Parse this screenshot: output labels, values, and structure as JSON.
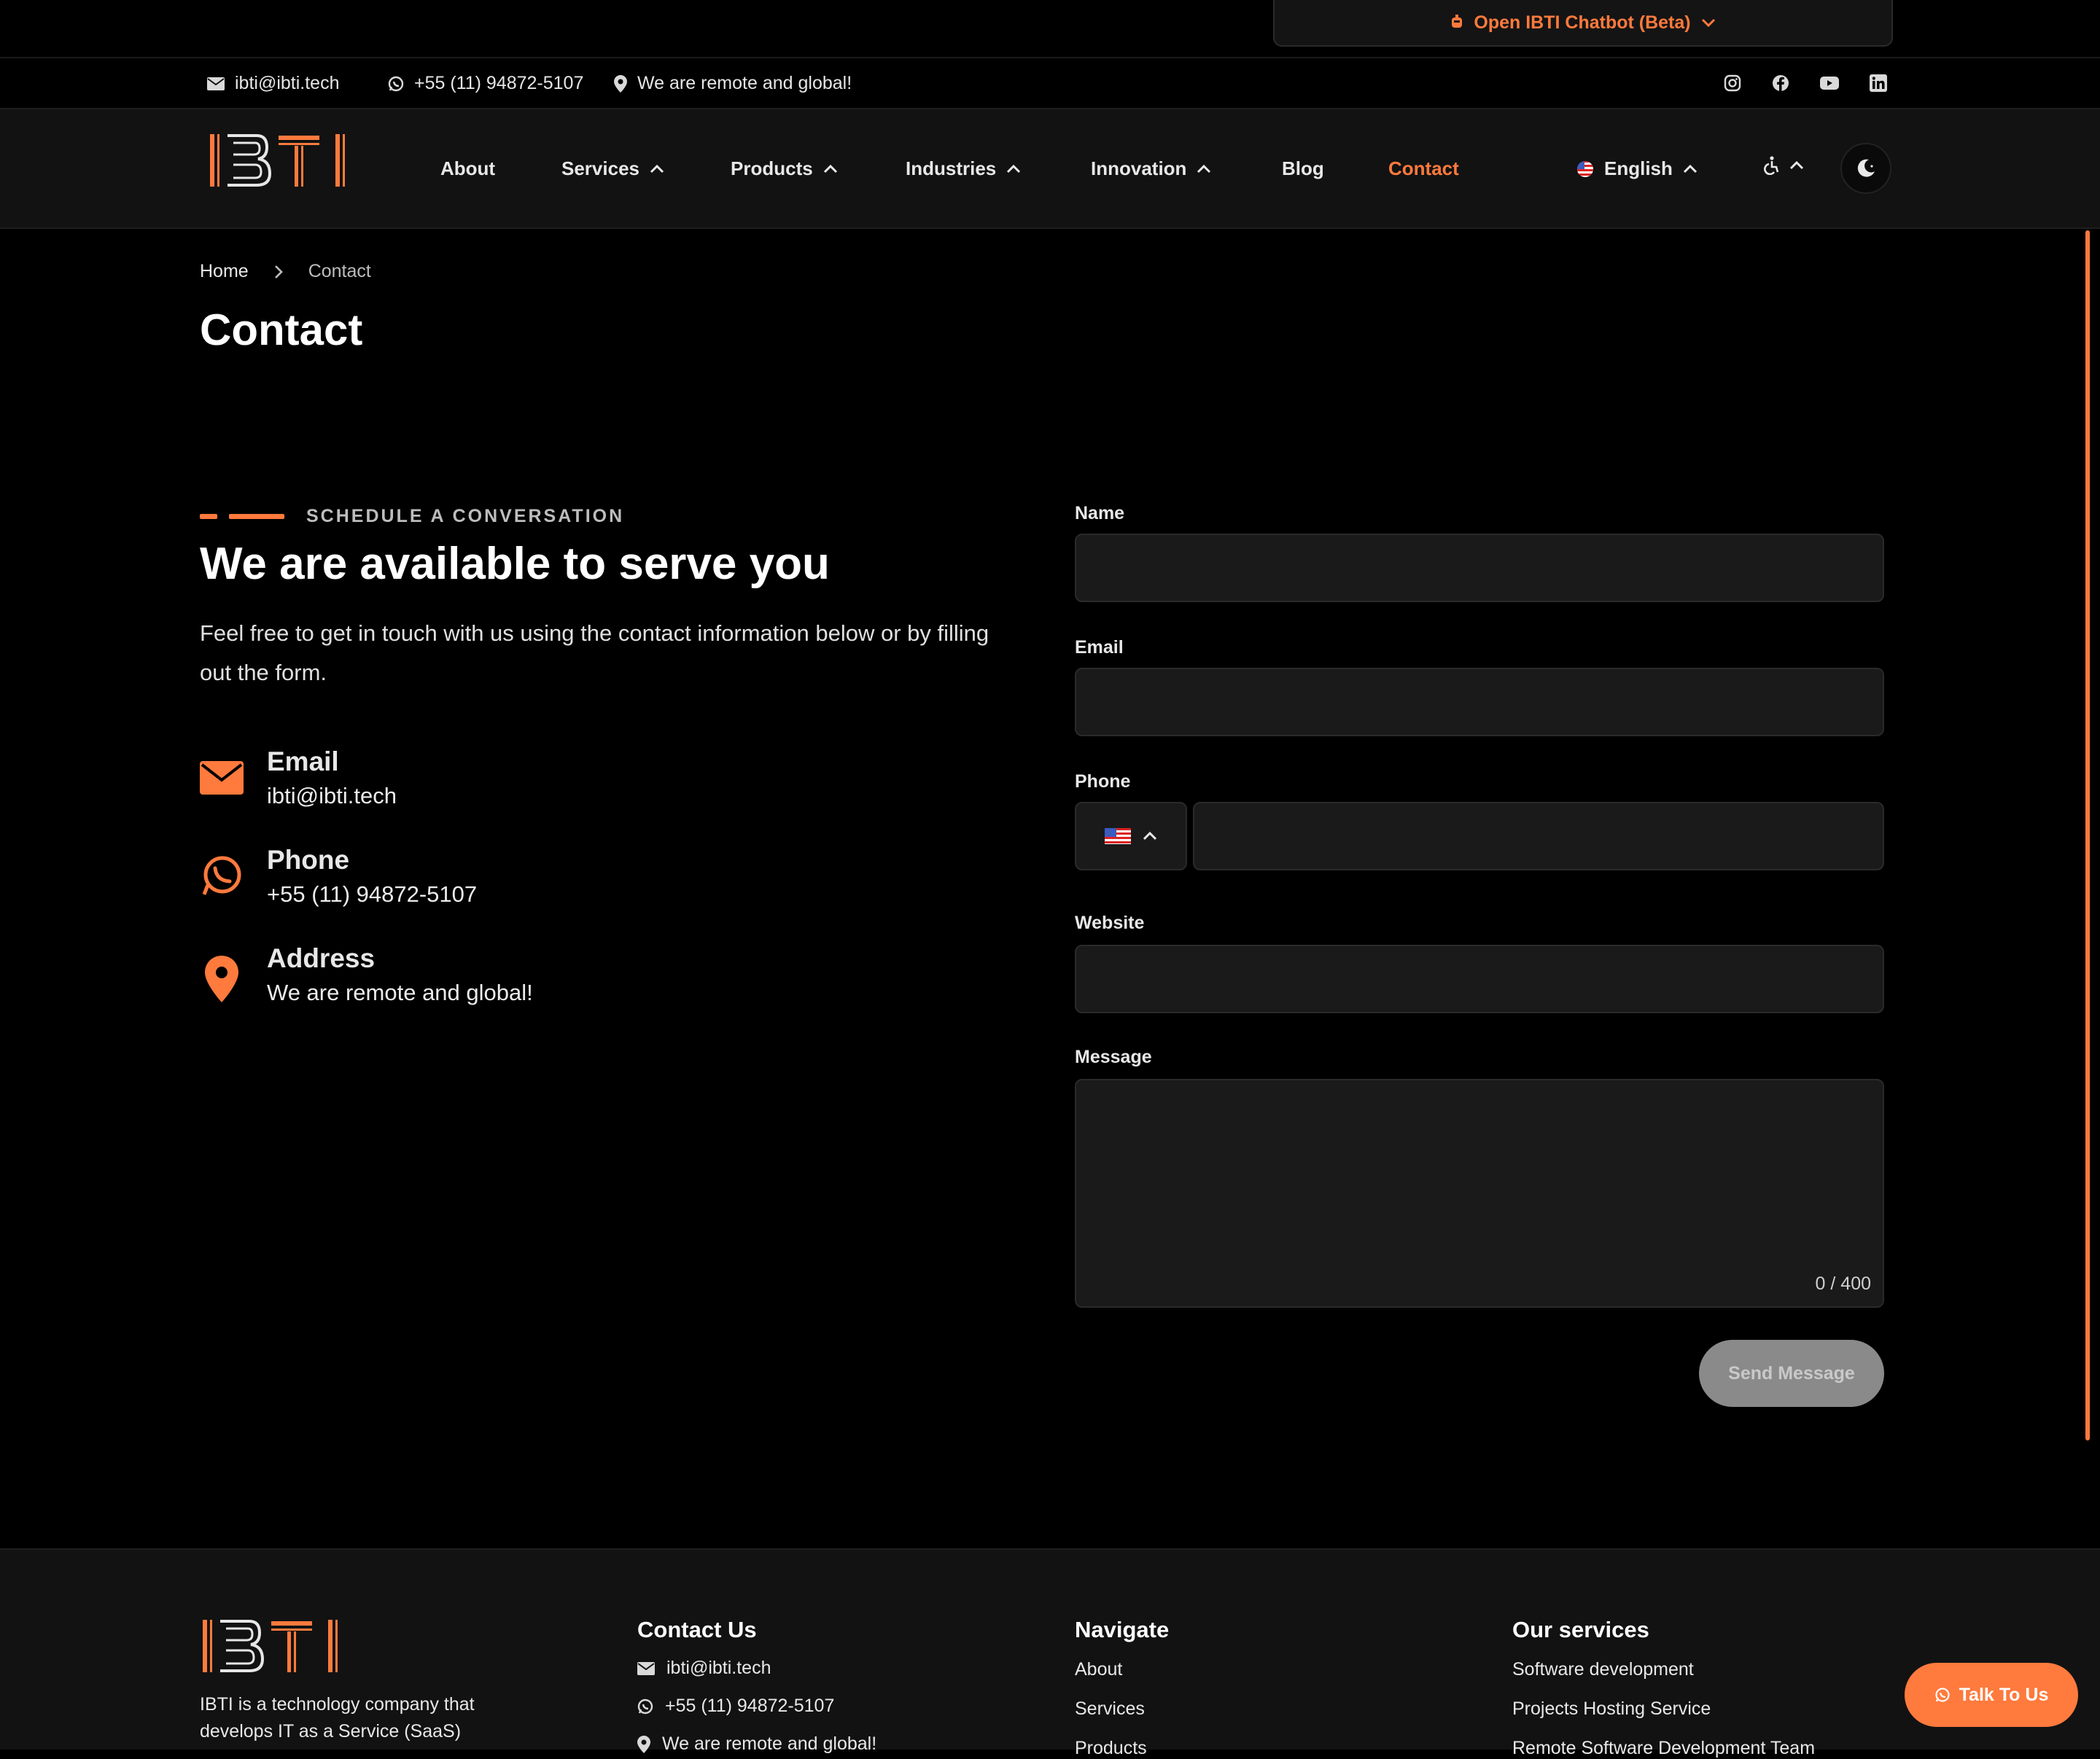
{
  "chatbot": {
    "label": "Open IBTI Chatbot (Beta)",
    "icon": "robot-icon",
    "chevron": "chevron-down-icon"
  },
  "infobar": {
    "email": "ibti@ibti.tech",
    "phone": "+55 (11) 94872-5107",
    "location": "We are remote and global!",
    "social": [
      "instagram-icon",
      "facebook-icon",
      "youtube-icon",
      "linkedin-icon"
    ]
  },
  "nav": {
    "logo": "IBTI",
    "items": [
      {
        "label": "About",
        "has_menu": false
      },
      {
        "label": "Services",
        "has_menu": true
      },
      {
        "label": "Products",
        "has_menu": true
      },
      {
        "label": "Industries",
        "has_menu": true
      },
      {
        "label": "Innovation",
        "has_menu": true
      },
      {
        "label": "Blog",
        "has_menu": false
      },
      {
        "label": "Contact",
        "has_menu": false,
        "active": true
      }
    ],
    "language": "English"
  },
  "breadcrumb": {
    "home": "Home",
    "current": "Contact"
  },
  "page_title": "Contact",
  "intro": {
    "eyebrow": "SCHEDULE A CONVERSATION",
    "heading": "We are available to serve you",
    "text": "Feel free to get in touch with us using the contact information below or by filling out the form."
  },
  "contact_info": [
    {
      "icon": "envelope-icon",
      "title": "Email",
      "value": "ibti@ibti.tech"
    },
    {
      "icon": "whatsapp-icon",
      "title": "Phone",
      "value": "+55 (11) 94872-5107"
    },
    {
      "icon": "map-pin-icon",
      "title": "Address",
      "value": "We are remote and global!"
    }
  ],
  "form": {
    "name_label": "Name",
    "email_label": "Email",
    "phone_label": "Phone",
    "website_label": "Website",
    "message_label": "Message",
    "counter": "0 / 400",
    "submit": "Send Message"
  },
  "footer": {
    "logo": "IBTI",
    "about": "IBTI is a technology company that develops IT as a Service (SaaS)",
    "contact_heading": "Contact Us",
    "email": "ibti@ibti.tech",
    "phone": "+55 (11) 94872-5107",
    "location": "We are remote and global!",
    "navigate_heading": "Navigate",
    "navigate": [
      "About",
      "Services",
      "Products"
    ],
    "services_heading": "Our services",
    "services": [
      "Software development",
      "Projects Hosting Service",
      "Remote Software Development Team"
    ]
  },
  "talk_button": "Talk To Us",
  "colors": {
    "accent": "#ff7a3d",
    "background": "#000000",
    "panel": "#121212",
    "input": "#1a1a1a"
  }
}
